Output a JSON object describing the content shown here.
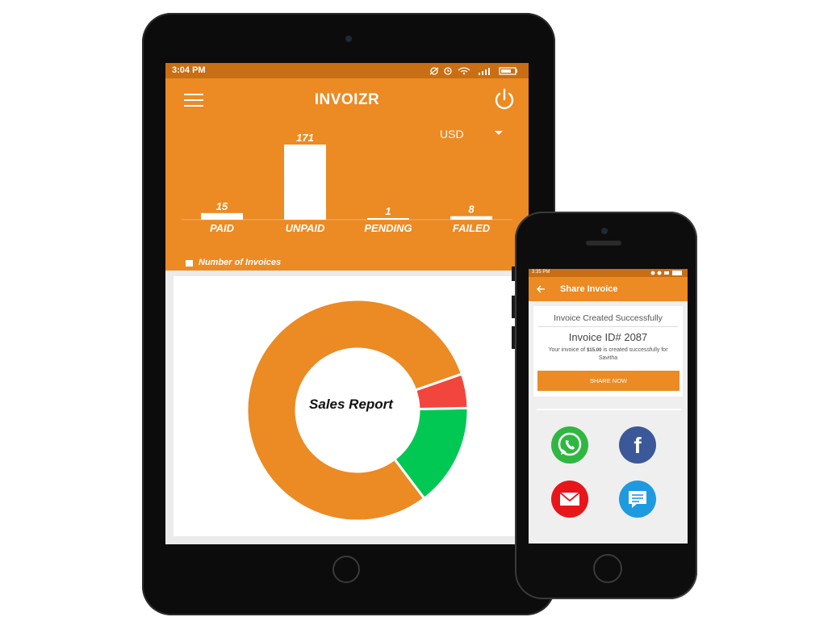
{
  "tablet": {
    "status_time": "3:04 PM",
    "title": "INVOIZR",
    "currency": "USD",
    "legend_label": "Number of Invoices",
    "donut_center": "Sales Report"
  },
  "chart_data": [
    {
      "type": "bar",
      "categories": [
        "PAID",
        "UNPAID",
        "PENDING",
        "FAILED"
      ],
      "values": [
        15,
        171,
        1,
        8
      ],
      "title": "",
      "legend": [
        "Number of Invoices"
      ],
      "legend_position": "bottom-left"
    },
    {
      "type": "pie",
      "title": "Sales Report",
      "slices": [
        {
          "color": "#ec8a23",
          "share": 0.8
        },
        {
          "color": "#f2453d",
          "share": 0.05
        },
        {
          "color": "#00c853",
          "share": 0.15
        }
      ]
    }
  ],
  "phone": {
    "status_time": "3:35 PM",
    "title": "Share Invoice",
    "success_title": "Invoice Created Successfully",
    "invoice_id": "Invoice ID# 2087",
    "message_prefix": "Your invoice of ",
    "amount": "$15.00",
    "message_suffix": " is created successfully for",
    "customer": "Savitha",
    "share_button": "SHARE NOW",
    "share_icons": [
      "whatsapp-icon",
      "facebook-icon",
      "email-icon",
      "sms-icon"
    ]
  },
  "colors": {
    "brand_orange": "#ec8a23",
    "status_orange": "#c86e14",
    "failed_red": "#f2453d",
    "success_green": "#00c853",
    "facebook_blue": "#3b5998",
    "whatsapp_green": "#2fb741",
    "email_red": "#e8161a",
    "sms_blue": "#1e9ae0"
  }
}
